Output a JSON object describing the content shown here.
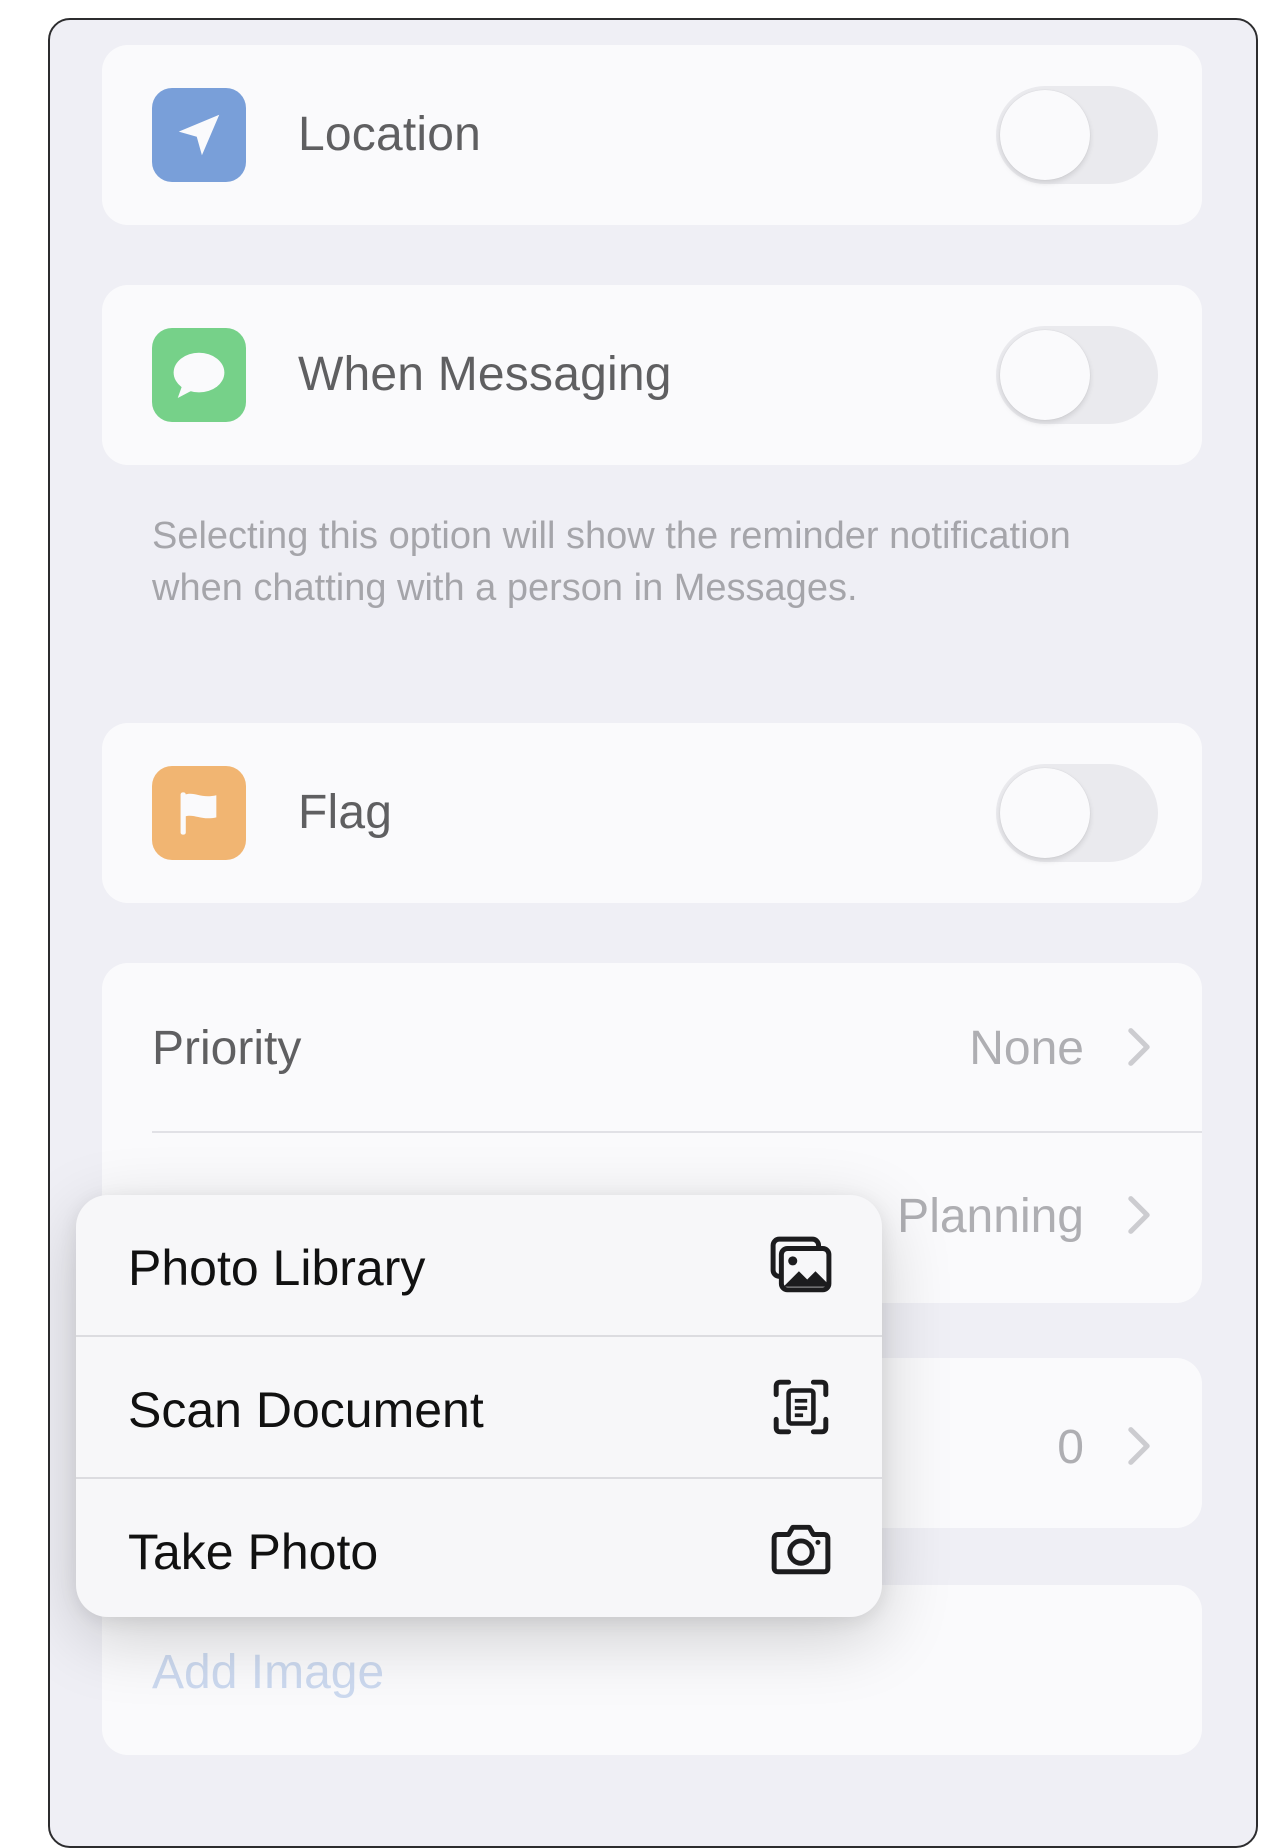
{
  "settings": {
    "location": {
      "label": "Location",
      "icon": "location-arrow-icon",
      "icon_color": "#3a74c9",
      "on": false
    },
    "messaging": {
      "label": "When Messaging",
      "icon": "message-bubble-icon",
      "icon_color": "#35c04f",
      "on": false
    },
    "messaging_footnote": "Selecting this option will show the reminder notification when chatting with a person in Messages.",
    "flag": {
      "label": "Flag",
      "icon": "flag-icon",
      "icon_color": "#f2962c",
      "on": false
    }
  },
  "details": {
    "priority": {
      "label": "Priority",
      "value": "None"
    },
    "list": {
      "value": "Planning"
    },
    "subtasks": {
      "value": "0"
    },
    "add_image": "Add Image"
  },
  "context_menu": {
    "items": [
      {
        "label": "Photo Library",
        "icon": "photo-library-icon"
      },
      {
        "label": "Scan Document",
        "icon": "scan-document-icon"
      },
      {
        "label": "Take Photo",
        "icon": "camera-icon"
      }
    ]
  },
  "colors": {
    "background": "#efeff4",
    "card": "#ffffff",
    "toggle_off": "#e7e7ea",
    "secondary_text": "#8a8a8e",
    "link_text": "#b9cdeb"
  }
}
